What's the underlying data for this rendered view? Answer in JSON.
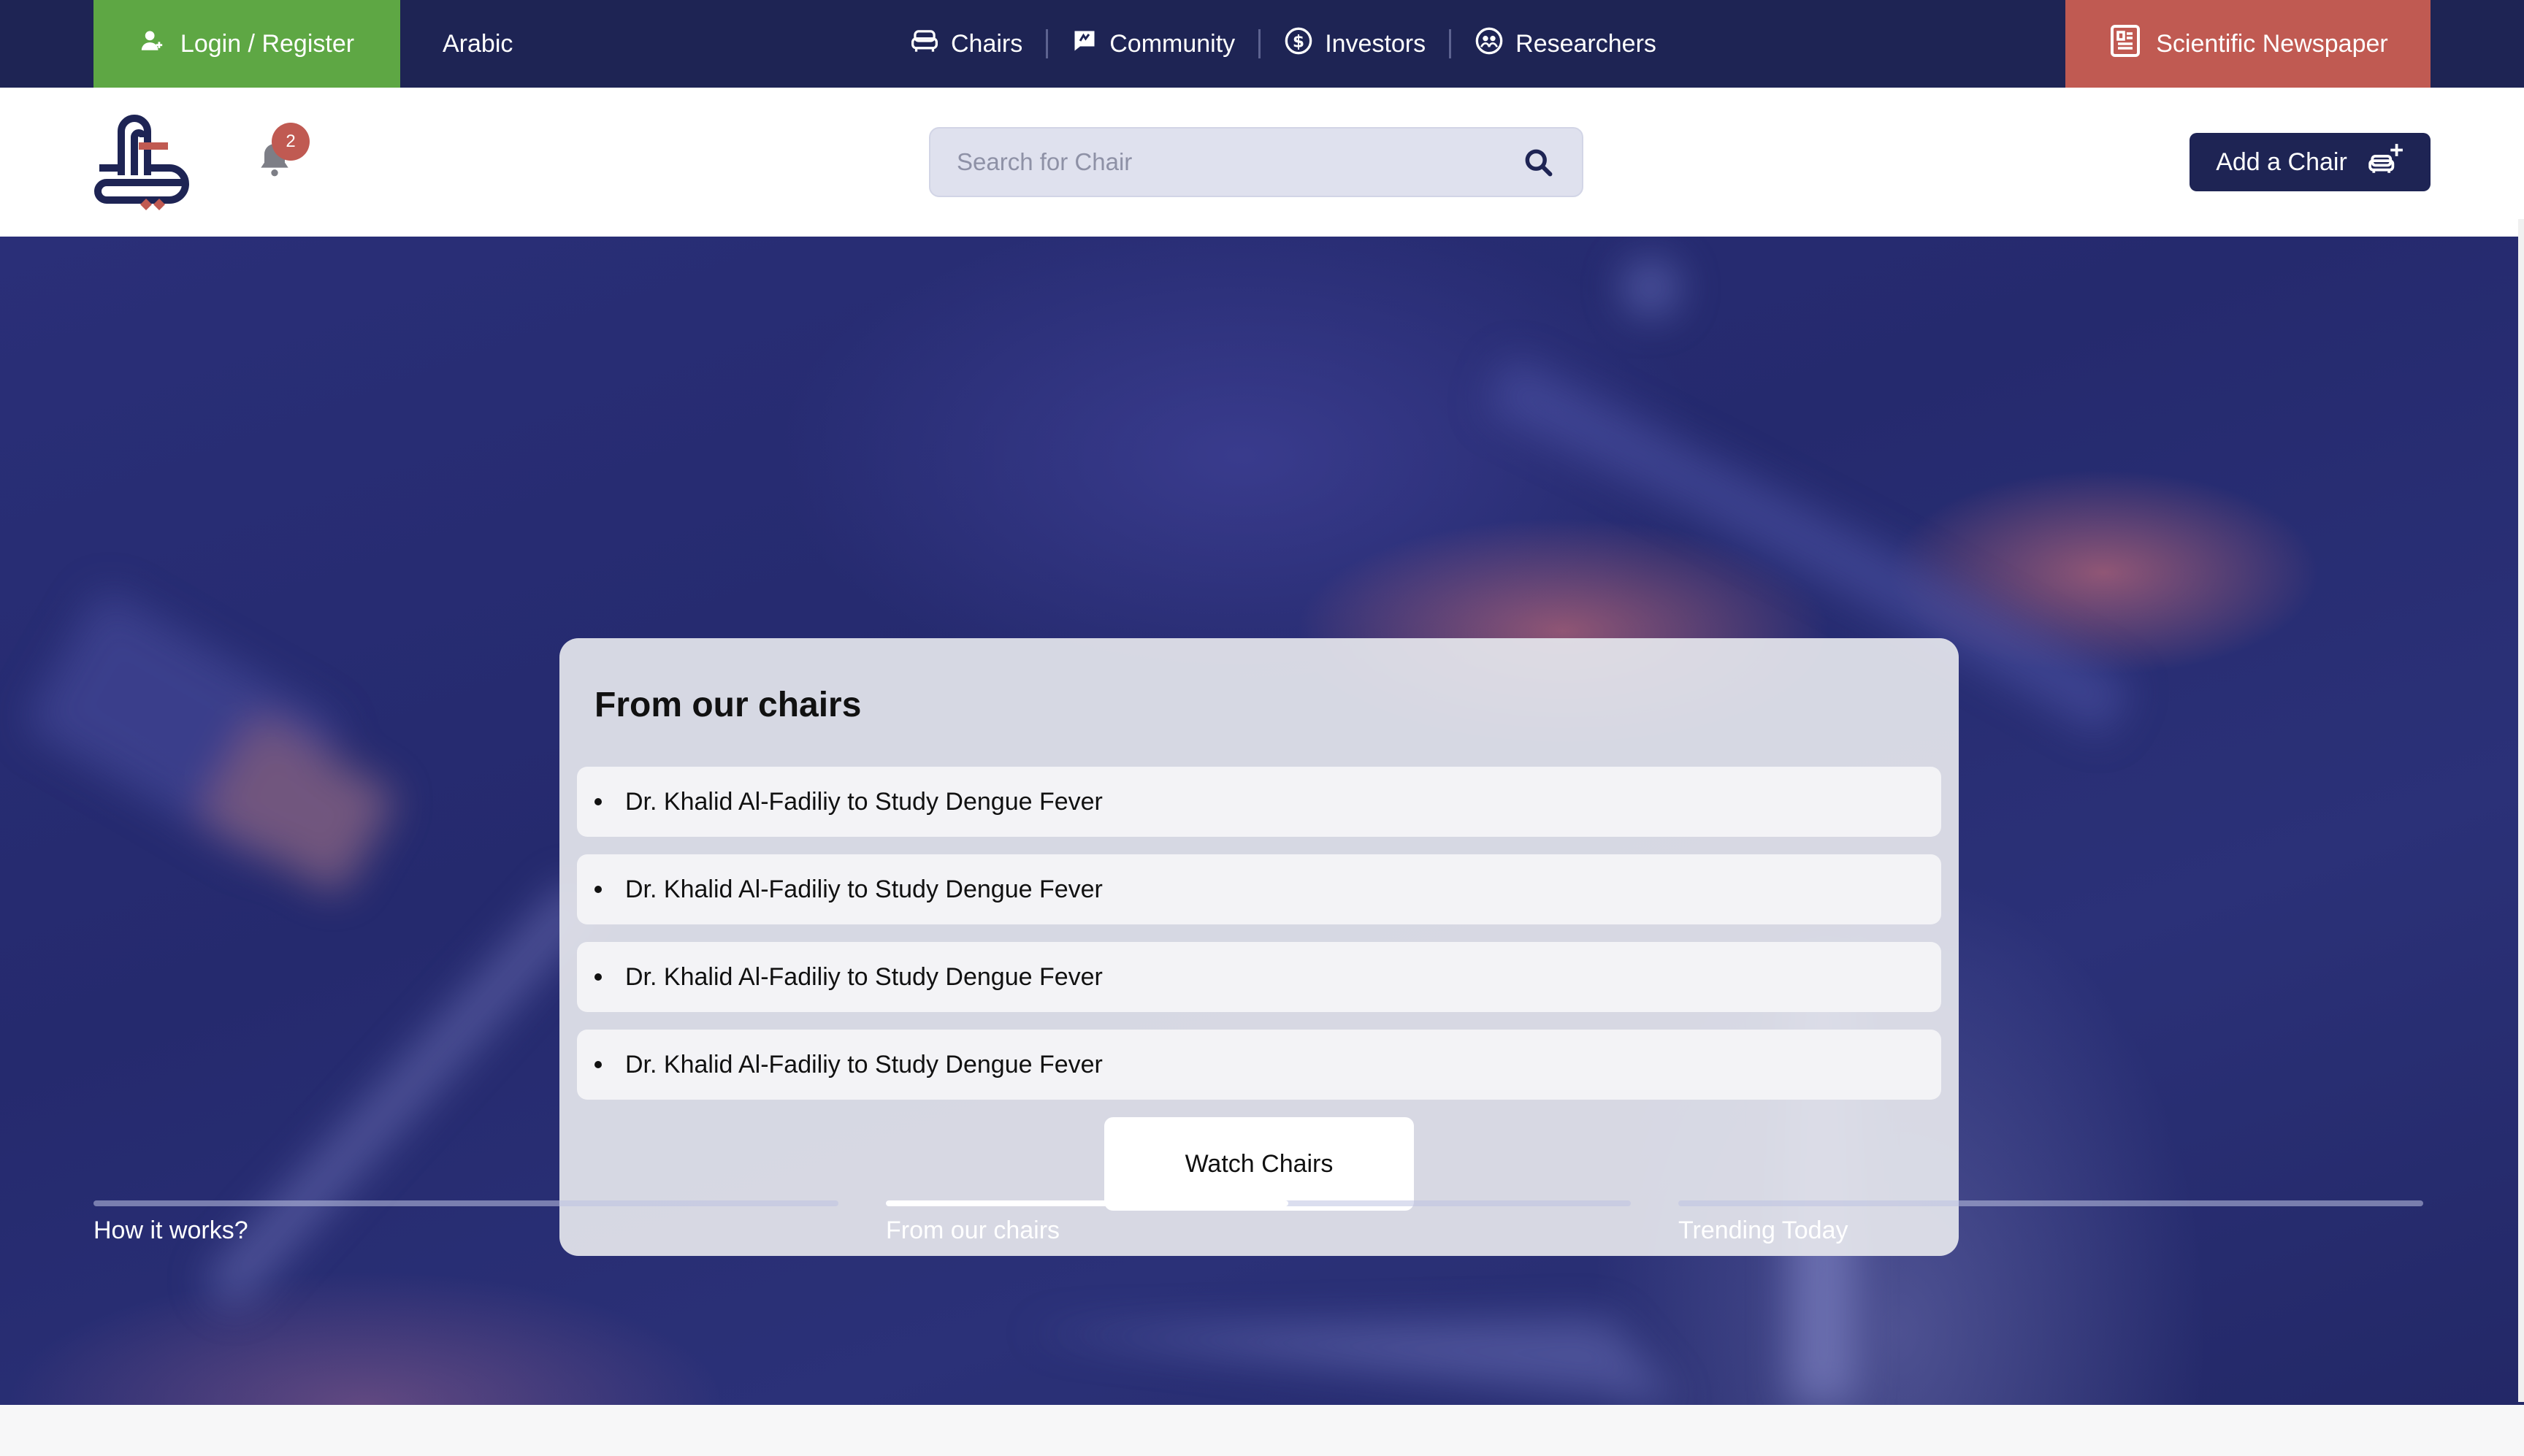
{
  "topbar": {
    "login_label": "Login / Register",
    "language_label": "Arabic",
    "nav": [
      {
        "label": "Chairs",
        "icon": "sofa-icon"
      },
      {
        "label": "Community",
        "icon": "chat-icon"
      },
      {
        "label": "Investors",
        "icon": "dollar-icon"
      },
      {
        "label": "Researchers",
        "icon": "researchers-icon"
      }
    ],
    "newspaper_label": "Scientific Newspaper"
  },
  "header": {
    "notification_count": "2",
    "search_placeholder": "Search for Chair",
    "add_chair_label": "Add a Chair"
  },
  "hero": {
    "card_title": "From our chairs",
    "items": [
      "Dr. Khalid Al-Fadiliy to Study Dengue Fever",
      "Dr. Khalid Al-Fadiliy to Study Dengue Fever",
      "Dr. Khalid Al-Fadiliy to Study Dengue Fever",
      "Dr. Khalid Al-Fadiliy to Study Dengue Fever"
    ],
    "watch_button_label": "Watch Chairs",
    "tabs": [
      {
        "label": "How it works?",
        "progress": 0
      },
      {
        "label": "From our chairs",
        "progress": 0.54
      },
      {
        "label": "Trending Today",
        "progress": 0
      }
    ]
  },
  "colors": {
    "navy": "#1e2454",
    "green": "#5ea744",
    "red": "#c05a52",
    "hero_blue": "#282d72"
  }
}
